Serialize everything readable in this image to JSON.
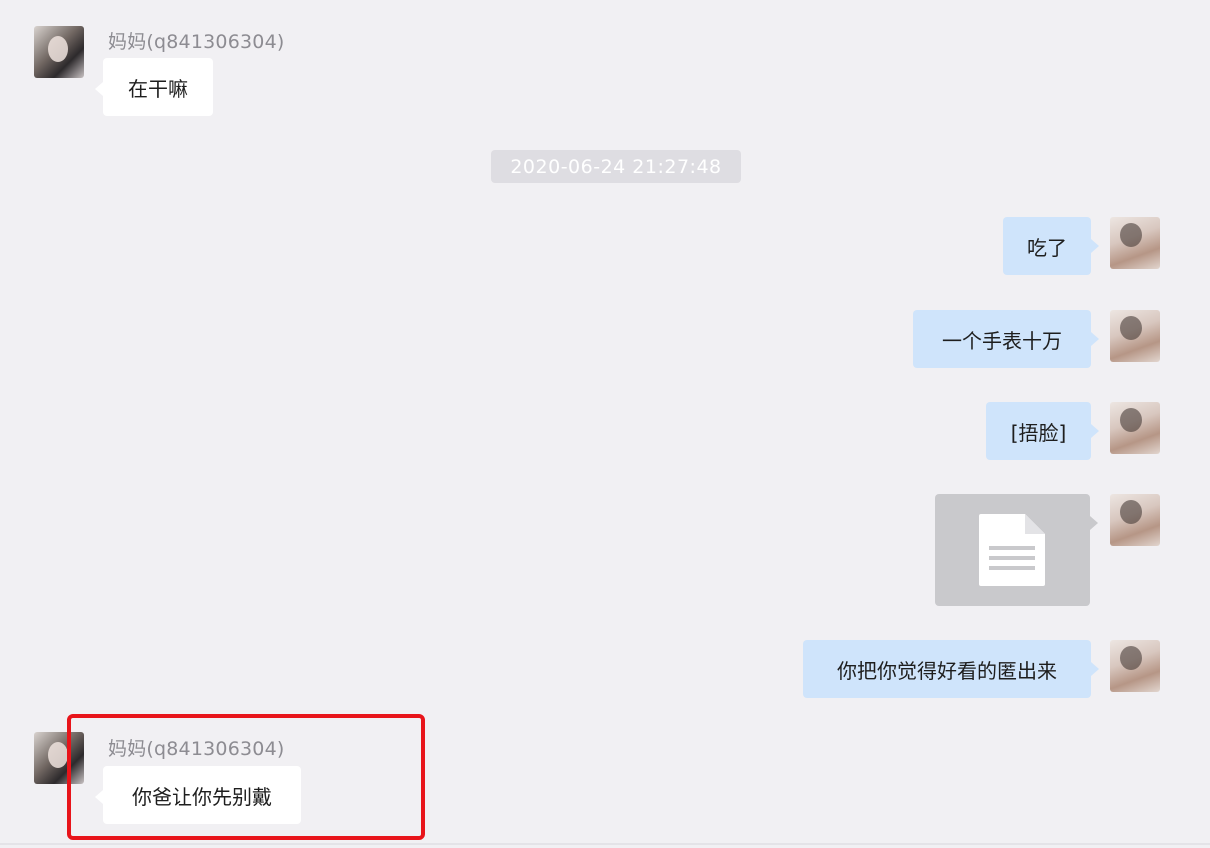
{
  "chat": {
    "messages": [
      {
        "sender": "妈妈(q841306304)",
        "text": "在干嘛"
      },
      {
        "text": "吃了"
      },
      {
        "text": "一个手表十万"
      },
      {
        "text": "[捂脸]"
      },
      {
        "type": "file",
        "icon": "document-icon"
      },
      {
        "text": "你把你觉得好看的匿出来"
      },
      {
        "sender": "妈妈(q841306304)",
        "text": "你爸让你先别戴"
      }
    ],
    "timestamp": "2020-06-24 21:27:48"
  },
  "colors": {
    "background": "#f1f0f3",
    "incoming_bubble": "#ffffff",
    "outgoing_bubble": "#cfe4fb",
    "highlight": "#e8141a"
  }
}
